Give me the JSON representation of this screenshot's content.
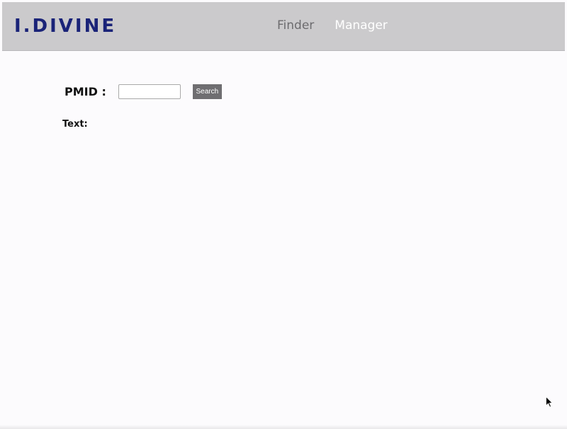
{
  "header": {
    "logo_text": "I.DIVINE",
    "nav": [
      {
        "label": "Finder"
      },
      {
        "label": "Manager"
      }
    ]
  },
  "search": {
    "label": "PMID :",
    "input_value": "",
    "button_label": "Search"
  },
  "content": {
    "text_label": "Text:"
  },
  "colors": {
    "header_bg": "#cbcacc",
    "logo": "#1a2378",
    "nav_inactive": "#6c6b6e",
    "nav_active": "#ffffff",
    "button_bg": "#6f6e71"
  },
  "icons": {
    "cursor": "mouse-pointer-icon"
  }
}
